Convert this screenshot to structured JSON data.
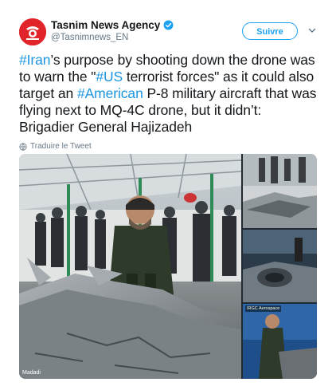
{
  "account": {
    "name": "Tasnim News Agency",
    "handle": "@Tasnimnews_EN",
    "avatar_color": "#e0242a",
    "verified_color": "#1da1f2"
  },
  "follow_button": {
    "label": "Suivre"
  },
  "tweet": {
    "segments": [
      {
        "text": "#Iran",
        "type": "hashtag"
      },
      {
        "text": "’s purpose by shooting down the drone was to warn the \"",
        "type": "text"
      },
      {
        "text": "#US",
        "type": "hashtag"
      },
      {
        "text": " terrorist forces\" as it could also target an ",
        "type": "text"
      },
      {
        "text": "#American",
        "type": "hashtag"
      },
      {
        "text": " P-8 military aircraft that was flying next to MQ-4C drone, but it didn’t: Brigadier General Hajizadeh",
        "type": "text"
      }
    ]
  },
  "translate": {
    "label": "Traduire le Tweet",
    "icon": "globe-icon"
  },
  "media": {
    "watermark": "Madadi",
    "inset_label": "IRGC Aerospace"
  },
  "colors": {
    "hashtag": "#1b95e0",
    "text": "#14171a",
    "muted": "#657786"
  }
}
